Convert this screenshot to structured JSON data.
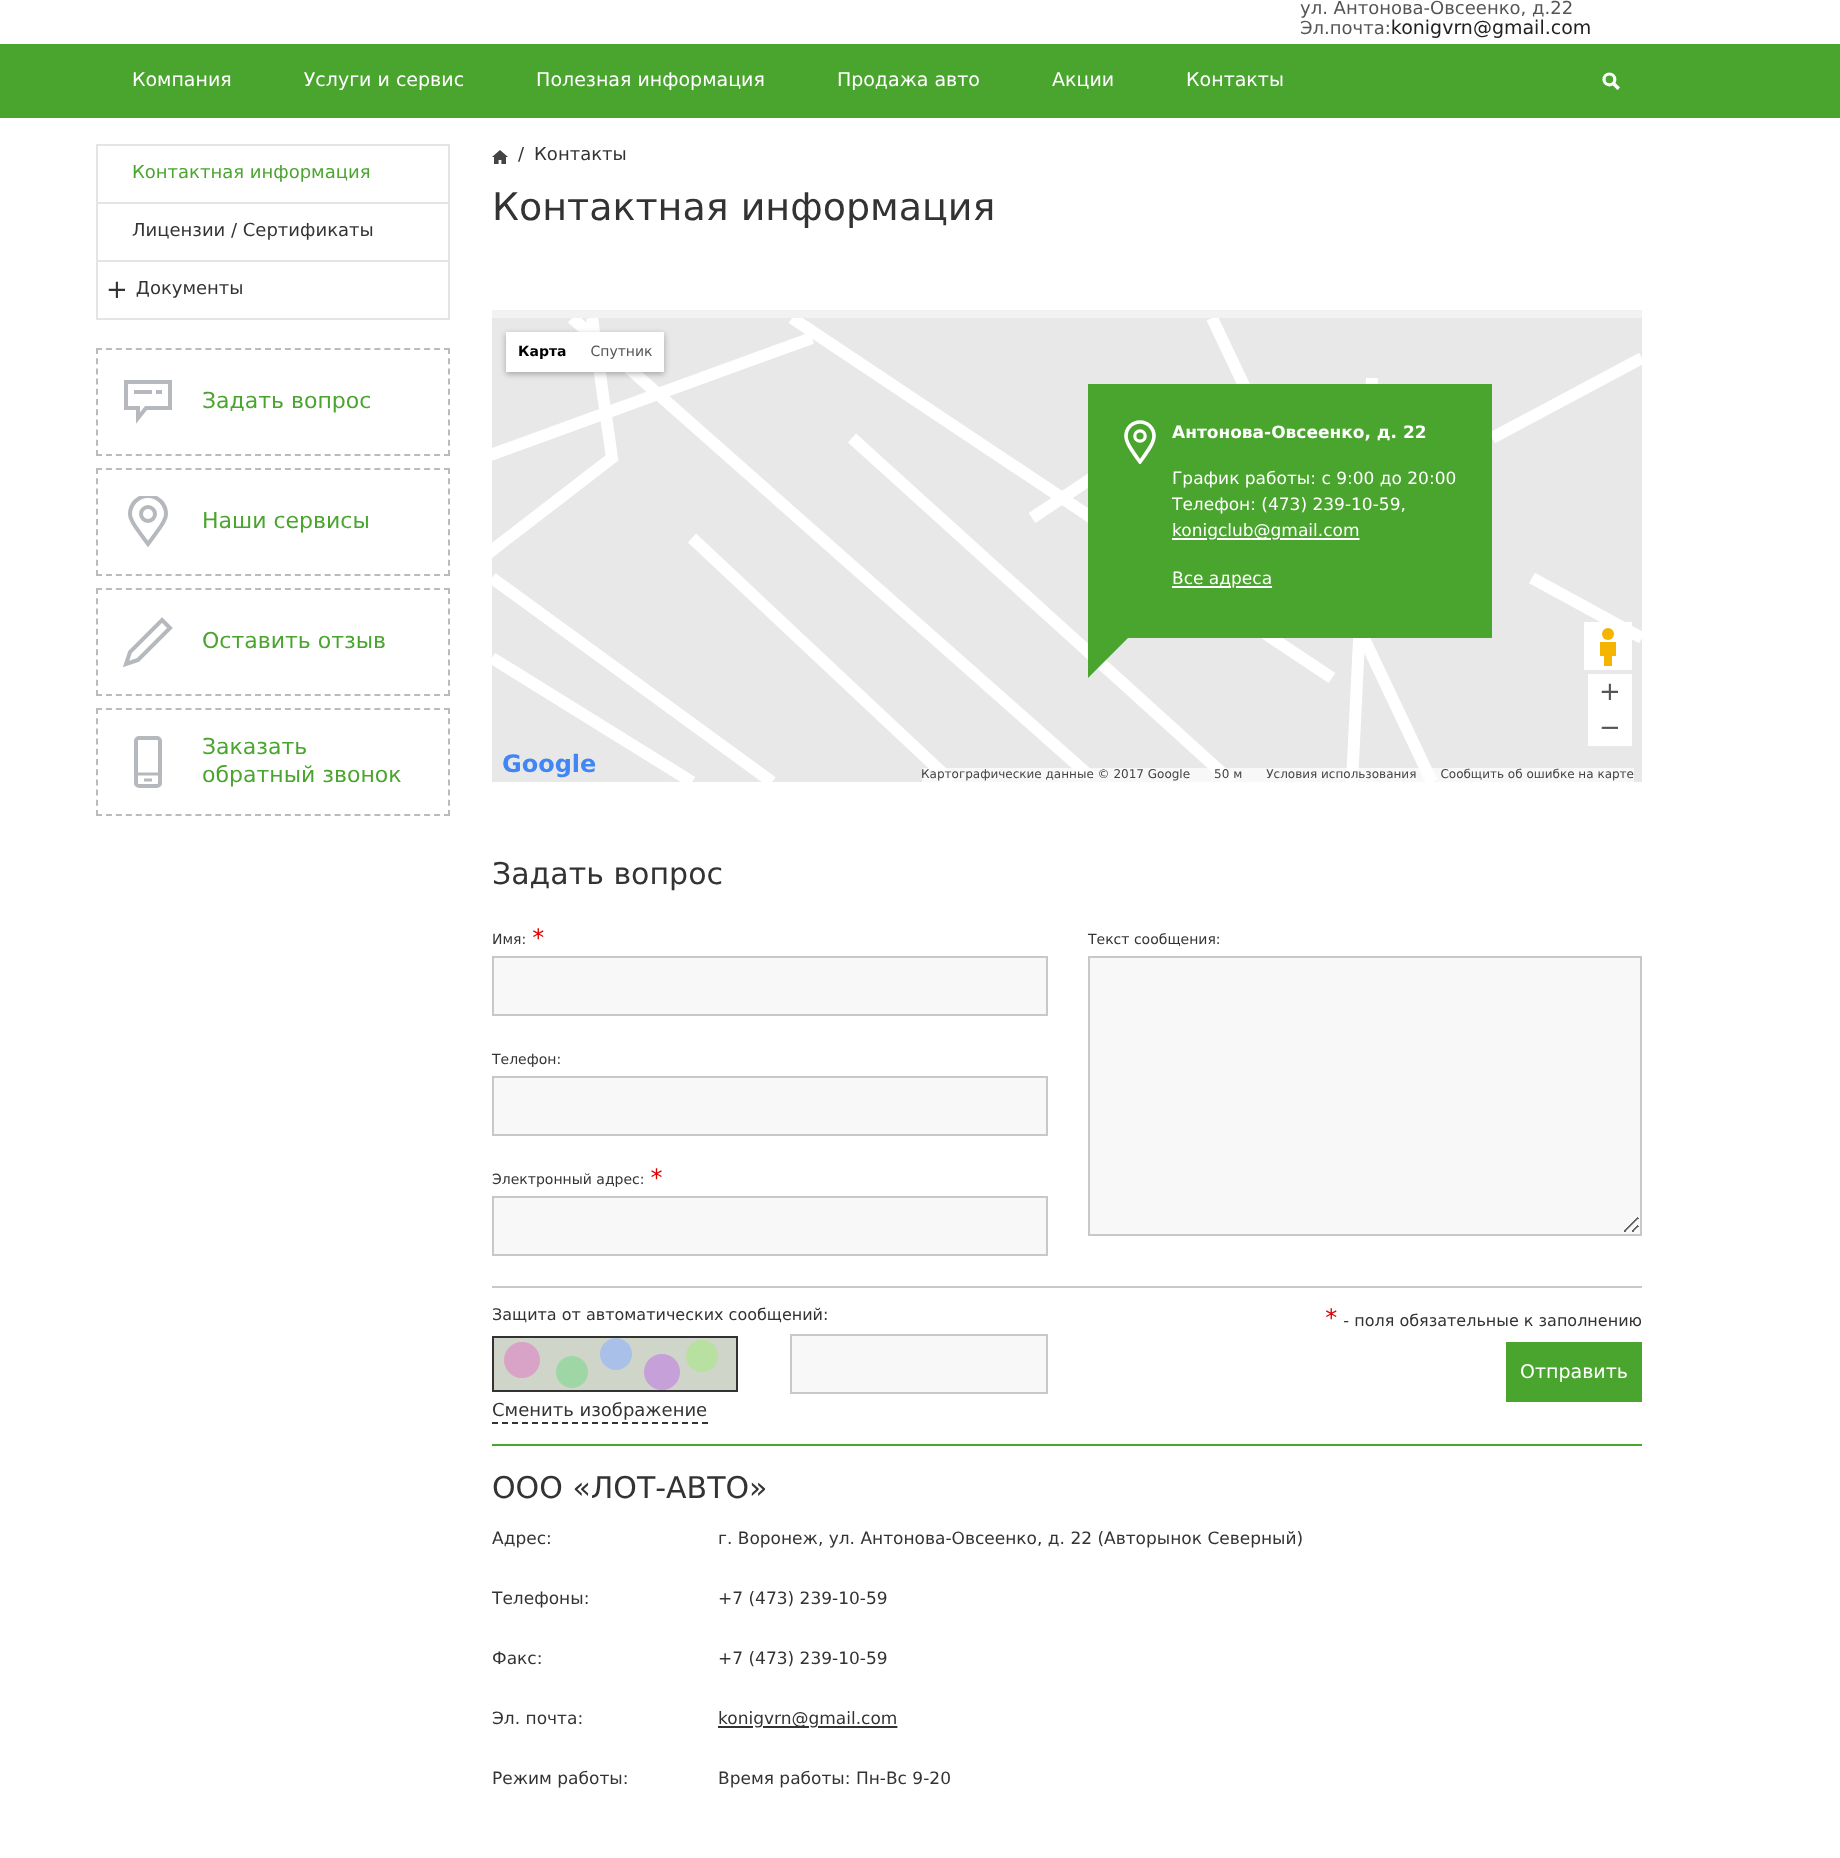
{
  "header": {
    "address": "ул. Антонова-Овсеенко, д.22",
    "email_label": "Эл.почта:",
    "email": "konigvrn@gmail.com"
  },
  "nav": {
    "items": [
      {
        "label": "Компания",
        "selected": false
      },
      {
        "label": "Услуги и сервис",
        "selected": false
      },
      {
        "label": "Полезная информация",
        "selected": false
      },
      {
        "label": "Продажа авто",
        "selected": false
      },
      {
        "label": "Акции",
        "selected": false
      },
      {
        "label": "Контакты",
        "selected": false
      }
    ]
  },
  "sidebar": {
    "menu": [
      {
        "label": "Контактная информация",
        "selected": true,
        "expandable": false
      },
      {
        "label": "Лицензии / Сертификаты",
        "selected": false,
        "expandable": false
      },
      {
        "label": "Документы",
        "selected": false,
        "expandable": true,
        "expand_mark": "+"
      }
    ],
    "actions": [
      {
        "label": "Задать вопрос",
        "kind": "chat"
      },
      {
        "label": "Наши сервисы",
        "kind": "pin"
      },
      {
        "label": "Оставить отзыв",
        "kind": "pencil"
      },
      {
        "label": "Заказать обратный звонок",
        "kind": "phone"
      }
    ]
  },
  "breadcrumb": {
    "separator": "/",
    "items": [
      "Контакты"
    ]
  },
  "title": "Контактная информация",
  "map": {
    "type_buttons": [
      {
        "label": "Карта",
        "selected": true
      },
      {
        "label": "Спутник",
        "selected": false
      }
    ],
    "popup": {
      "title": "Антонова-Овсеенко, д. 22",
      "schedule": "График работы: с 9:00 до 20:00",
      "phone": "Телефон: (473) 239-10-59,",
      "email": "konigclub@gmail.com",
      "link": "Все адреса"
    },
    "zoom_in": "+",
    "zoom_out": "−",
    "logo": "Google",
    "attribution": [
      "Картографические данные © 2017 Google",
      "50 м",
      "Условия использования",
      "Сообщить об ошибке на карте"
    ]
  },
  "form": {
    "title": "Задать вопрос",
    "required_mark": "*",
    "fields": [
      {
        "label": "Имя:",
        "required": true,
        "kind": "input"
      },
      {
        "label": "Телефон:",
        "required": false,
        "kind": "input"
      },
      {
        "label": "Электронный адрес:",
        "required": true,
        "kind": "input"
      },
      {
        "label": "Текст сообщения:",
        "required": false,
        "kind": "textarea"
      }
    ],
    "captcha_label": "Защита от автоматических сообщений:",
    "change_image": "Сменить изображение",
    "required_note": "- поля обязательные к заполнению",
    "submit": "Отправить"
  },
  "company": {
    "name": "ООО «ЛОТ-АВТО»",
    "rows": [
      {
        "label": "Адрес:",
        "value": "г. Воронеж, ул. Антонова-Овсеенко, д. 22 (Авторынок Северный)",
        "kind": "text"
      },
      {
        "label": "Телефоны:",
        "value": "+7 (473) 239-10-59",
        "kind": "text"
      },
      {
        "label": "Факс:",
        "value": "+7 (473) 239-10-59",
        "kind": "text"
      },
      {
        "label": "Эл. почта:",
        "value": "konigvrn@gmail.com",
        "kind": "link"
      },
      {
        "label": "Режим работы:",
        "value": "Время работы: Пн-Вс 9-20",
        "kind": "text"
      }
    ]
  }
}
